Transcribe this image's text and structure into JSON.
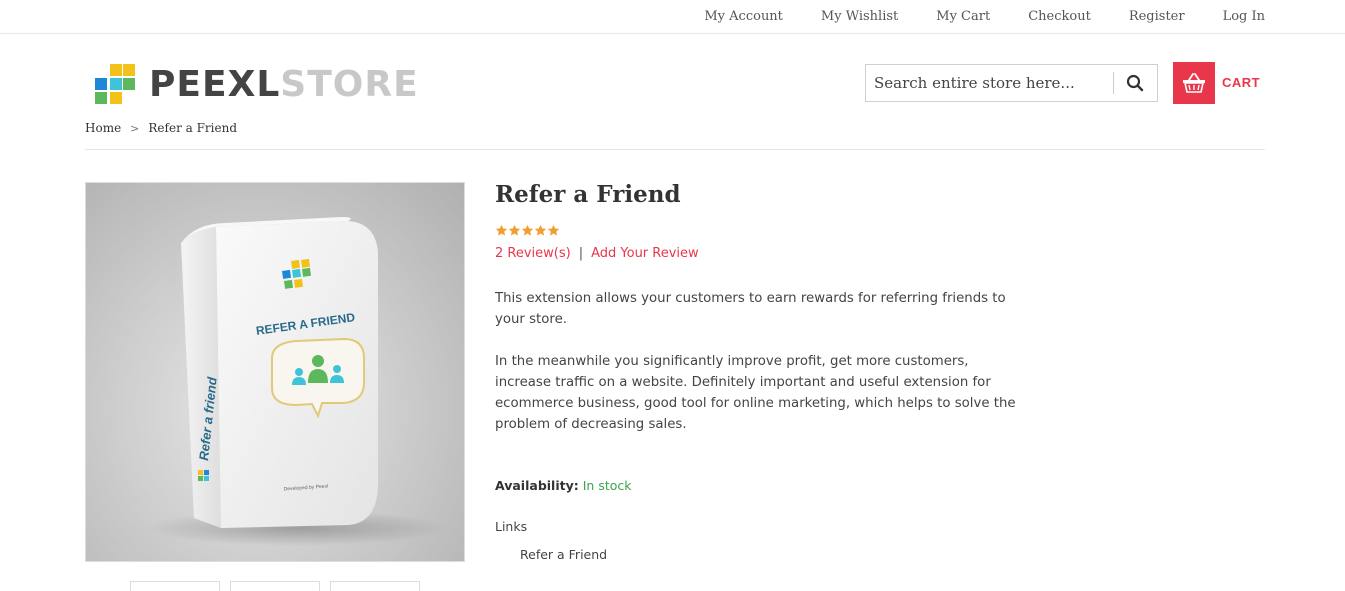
{
  "top_links": [
    "My Account",
    "My Wishlist",
    "My Cart",
    "Checkout",
    "Register",
    "Log In"
  ],
  "logo": {
    "text_dark": "PEEXL",
    "text_light": "STORE"
  },
  "search": {
    "placeholder": "Search entire store here..."
  },
  "cart": {
    "label": "CART"
  },
  "breadcrumb": {
    "home": "Home",
    "separator": ">",
    "current": "Refer a Friend"
  },
  "product": {
    "name": "Refer a Friend",
    "rating": {
      "stars": 5,
      "max": 5
    },
    "reviews_link": "2 Review(s)",
    "review_separator": "|",
    "add_review_link": "Add Your Review",
    "description": [
      "This extension allows your customers to earn rewards for referring friends to your store.",
      "In the meanwhile you significantly improve profit, get more customers, increase traffic on a website. Definitely important and useful extension for ecommerce business, good tool for online marketing, which helps to solve the problem of decreasing sales."
    ],
    "availability_label": "Availability:",
    "availability_value": "In stock",
    "links_title": "Links",
    "links": [
      "Refer a Friend"
    ],
    "box_title": "REFER A FRIEND",
    "box_side_text": "Refer a friend",
    "box_footer": "Developed by Peexl"
  },
  "colors": {
    "accent": "#e8374a",
    "star": "#f0a030",
    "in_stock": "#3aa54a",
    "logo_blue": "#1e88d8",
    "logo_yellow": "#f2c21b",
    "logo_green": "#5cb85c",
    "logo_cyan": "#3fc3d8"
  }
}
